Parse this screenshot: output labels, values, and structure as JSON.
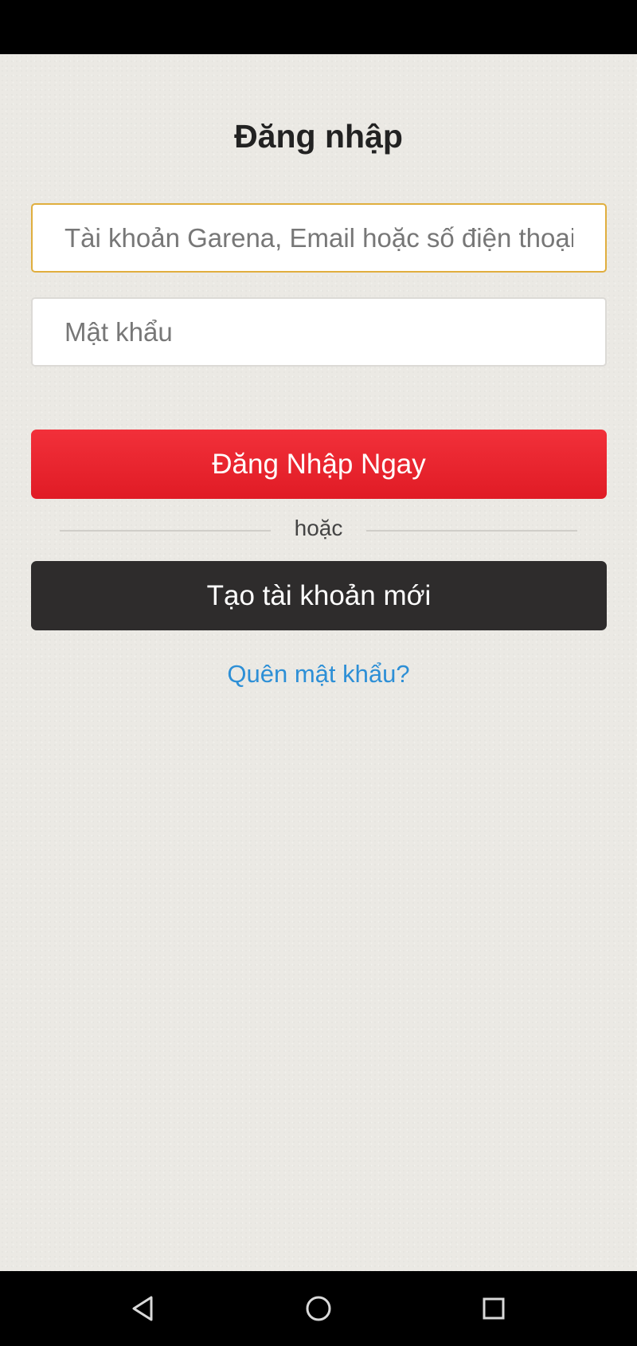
{
  "title": "Đăng nhập",
  "account_field": {
    "placeholder": "Tài khoản Garena, Email hoặc số điện thoại",
    "value": ""
  },
  "password_field": {
    "placeholder": "Mật khẩu",
    "value": ""
  },
  "login_button": {
    "label": "Đăng Nhập Ngay"
  },
  "divider_text": "hoặc",
  "register_button": {
    "label": "Tạo tài khoản mới"
  },
  "forgot_link": {
    "label": "Quên mật khẩu?"
  },
  "nav_bar": {
    "back_icon": "triangle-back-icon",
    "home_icon": "circle-home-icon",
    "recents_icon": "square-recents-icon"
  },
  "colors": {
    "background": "#ebe9e4",
    "focus_border": "#e0ae3e",
    "login_button": "#e8222c",
    "register_button": "#2e2c2c",
    "link": "#2d8fd6"
  }
}
